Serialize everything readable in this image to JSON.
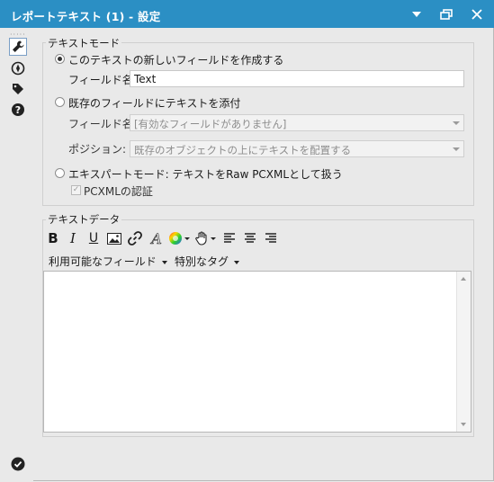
{
  "window": {
    "title": "レポートテキスト (1) - 設定"
  },
  "titlebar": {
    "controls": [
      "chevron-down-icon",
      "restore-icon",
      "close-icon"
    ]
  },
  "sidebar": {
    "icons": [
      "wrench-icon",
      "compass-icon",
      "tag-icon",
      "help-icon"
    ]
  },
  "text_mode": {
    "group_label": "テキストモード",
    "option_new": "このテキストの新しいフィールドを作成する",
    "field_name_label": "フィールド名:",
    "field_name_value": "Text",
    "option_append": "既存のフィールドにテキストを添付",
    "append_field_label": "フィールド名:",
    "append_field_value": "[有効なフィールドがありません]",
    "position_label": "ポジション:",
    "position_value": "既存のオブジェクトの上にテキストを配置する",
    "option_expert": "エキスパートモード:  テキストをRaw  PCXMLとして扱う",
    "pcxml_label": "PCXMLの認証",
    "selected": "option_new"
  },
  "text_data": {
    "group_label": "テキストデータ",
    "toolbar": {
      "bold": "B",
      "italic": "I",
      "underline": "U",
      "font": "A"
    },
    "available_fields": "利用可能なフィールド",
    "special_tags": "特別なタグ",
    "content": ""
  },
  "footer": {
    "status_icon": "check-circle-icon"
  }
}
